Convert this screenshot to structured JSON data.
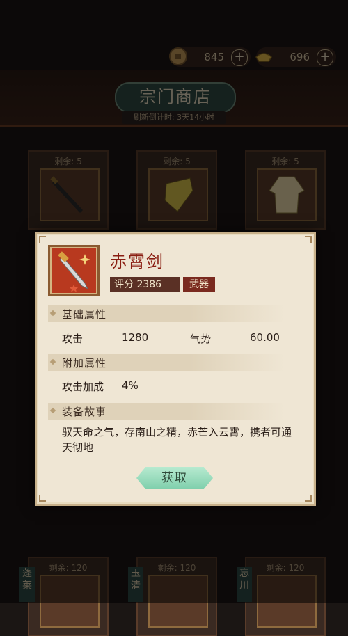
{
  "currency": [
    {
      "icon": "copper-coin-icon",
      "value": "845",
      "plus": "+"
    },
    {
      "icon": "gold-ingot-icon",
      "value": "696",
      "plus": "+"
    }
  ],
  "shop": {
    "title": "宗门商店",
    "refresh": "刷新倒计时: 3天14小时",
    "row1": [
      {
        "remain": "剩余: 5",
        "icon": "dagger-icon"
      },
      {
        "remain": "剩余: 5",
        "icon": "armor-icon"
      },
      {
        "remain": "剩余: 5",
        "icon": "robe-icon"
      }
    ],
    "row2": [
      {
        "remain": "剩余: 120",
        "tag": "蓬莱"
      },
      {
        "remain": "剩余: 120",
        "tag": "玉清"
      },
      {
        "remain": "剩余: 120",
        "tag": "忘川"
      }
    ]
  },
  "detail": {
    "name": "赤霄剑",
    "score": "评分 2386",
    "category": "武器",
    "base_title": "基础属性",
    "attack_label": "攻击",
    "attack_value": "1280",
    "momentum_label": "气势",
    "momentum_value": "60.00",
    "extra_title": "附加属性",
    "extra_label": "攻击加成",
    "extra_value": "4%",
    "story_title": "装备故事",
    "story": "驭天命之气，存南山之精，赤芒入云霄，携者可通天彻地",
    "button": "获取"
  },
  "colors": {
    "accent_red": "#8a1e12",
    "button_green": "#8fd6b5",
    "panel": "#efe6d4"
  }
}
